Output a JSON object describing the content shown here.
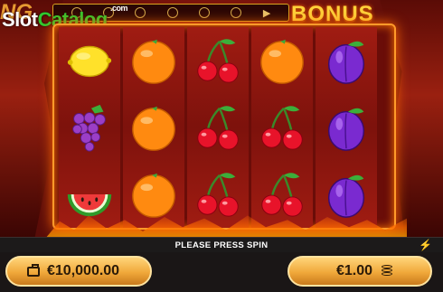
{
  "watermark": {
    "brand_part1": "Slot",
    "brand_part2": "Catalog",
    "brand_suffix": ".com"
  },
  "header": {
    "left_title_fragment": "NG",
    "right_title": "BONUS"
  },
  "top_bar": {
    "arrow_icon": "triangle-right-icon"
  },
  "reels": [
    [
      "lemon",
      "grapes",
      "watermelon"
    ],
    [
      "orange",
      "orange",
      "orange"
    ],
    [
      "cherries",
      "cherries",
      "cherries"
    ],
    [
      "orange",
      "cherries",
      "cherries"
    ],
    [
      "plum",
      "plum",
      "plum"
    ]
  ],
  "status": {
    "message": "PLEASE PRESS SPIN",
    "icon": "lightning-icon"
  },
  "balance": {
    "value": "€10,000.00",
    "icon": "wallet-icon"
  },
  "bet": {
    "value": "€1.00",
    "icon": "coin-stack-icon"
  },
  "colors": {
    "frame_glow": "#ff9a2a",
    "reel_bg": "#8e160e",
    "pill_gold": "#f0a83a",
    "bonus_text": "#ffd23a",
    "watermark_green": "#2fc92f"
  }
}
